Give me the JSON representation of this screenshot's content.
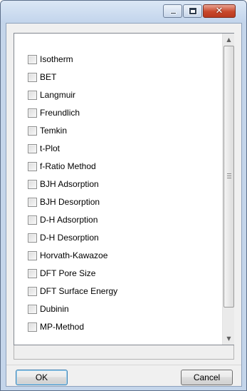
{
  "titlebar": {
    "minimize_icon": "minimize-icon",
    "maximize_icon": "maximize-icon",
    "close_icon": "close-icon",
    "close_glyph": "✕"
  },
  "list": {
    "items": [
      {
        "label": "Isotherm",
        "checked": false
      },
      {
        "label": "BET",
        "checked": false
      },
      {
        "label": "Langmuir",
        "checked": false
      },
      {
        "label": "Freundlich",
        "checked": false
      },
      {
        "label": "Temkin",
        "checked": false
      },
      {
        "label": "t-Plot",
        "checked": false
      },
      {
        "label": "f-Ratio Method",
        "checked": false
      },
      {
        "label": "BJH Adsorption",
        "checked": false
      },
      {
        "label": "BJH Desorption",
        "checked": false
      },
      {
        "label": "D-H Adsorption",
        "checked": false
      },
      {
        "label": "D-H Desorption",
        "checked": false
      },
      {
        "label": "Horvath-Kawazoe",
        "checked": false
      },
      {
        "label": "DFT Pore Size",
        "checked": false
      },
      {
        "label": "DFT Surface Energy",
        "checked": false
      },
      {
        "label": "Dubinin",
        "checked": false
      },
      {
        "label": "MP-Method",
        "checked": false
      }
    ]
  },
  "scrollbar": {
    "up_glyph": "▲",
    "down_glyph": "▼"
  },
  "buttons": {
    "ok_label": "OK",
    "cancel_label": "Cancel"
  },
  "colors": {
    "titlebar": "#c3d5ec",
    "close_button": "#c8472a",
    "client_background": "#f0f0f0"
  }
}
